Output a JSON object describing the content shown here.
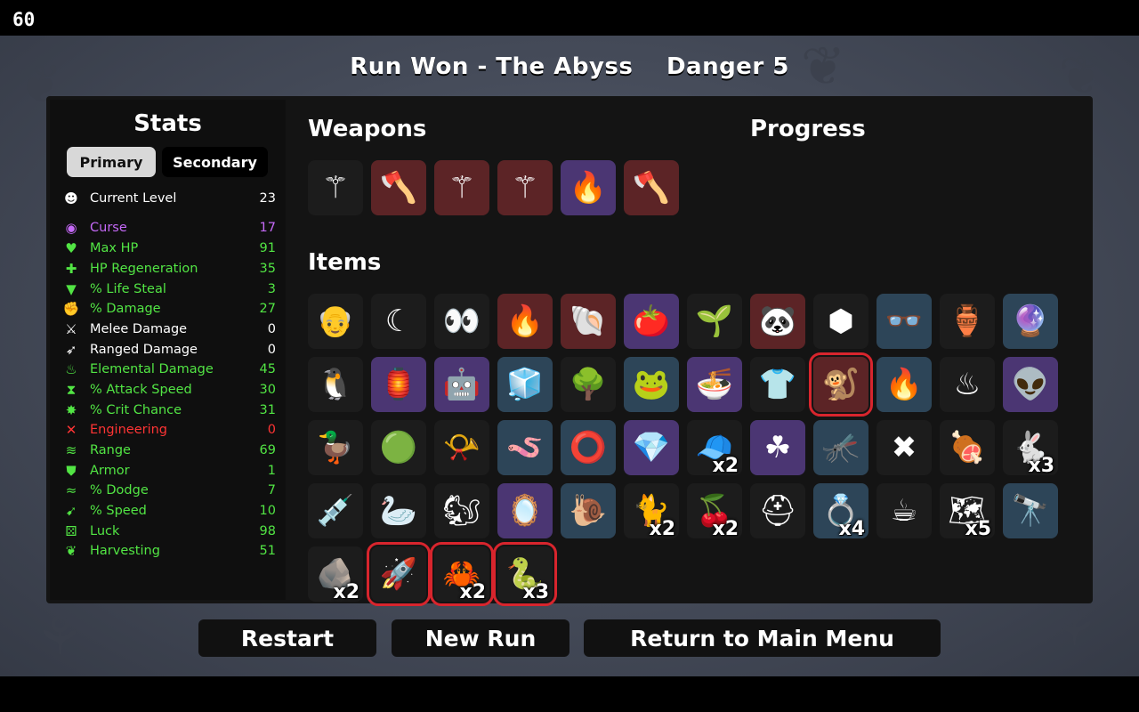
{
  "fps": "60",
  "title": {
    "run_result": "Run Won - The Abyss",
    "danger": "Danger 5"
  },
  "stats": {
    "title": "Stats",
    "tabs": {
      "primary": "Primary",
      "secondary": "Secondary"
    },
    "rows": [
      {
        "icon": "skull-level-icon",
        "glyph": "☻",
        "label": "Current Level",
        "value": "23",
        "color": "#ffffff"
      },
      {
        "icon": "curse-eye-icon",
        "glyph": "◉",
        "label": "Curse",
        "value": "17",
        "color": "#c569f7"
      },
      {
        "icon": "heart-icon",
        "glyph": "♥",
        "label": "Max HP",
        "value": "91",
        "color": "#52e544"
      },
      {
        "icon": "heart-plus-icon",
        "glyph": "✚",
        "label": "HP Regeneration",
        "value": "35",
        "color": "#52e544"
      },
      {
        "icon": "vampire-mouth-icon",
        "glyph": "▼",
        "label": "% Life Steal",
        "value": "3",
        "color": "#52e544"
      },
      {
        "icon": "fist-icon",
        "glyph": "✊",
        "label": "% Damage",
        "value": "27",
        "color": "#52e544"
      },
      {
        "icon": "sword-icon",
        "glyph": "⚔",
        "label": "Melee Damage",
        "value": "0",
        "color": "#ffffff"
      },
      {
        "icon": "bow-icon",
        "glyph": "➶",
        "label": "Ranged Damage",
        "value": "0",
        "color": "#ffffff"
      },
      {
        "icon": "flame-icon",
        "glyph": "♨",
        "label": "Elemental Damage",
        "value": "45",
        "color": "#52e544"
      },
      {
        "icon": "hourglass-icon",
        "glyph": "⧗",
        "label": "% Attack Speed",
        "value": "30",
        "color": "#52e544"
      },
      {
        "icon": "crit-star-icon",
        "glyph": "✸",
        "label": "% Crit Chance",
        "value": "31",
        "color": "#52e544"
      },
      {
        "icon": "wrench-icon",
        "glyph": "✕",
        "label": "Engineering",
        "value": "0",
        "color": "#ff3434"
      },
      {
        "icon": "range-waves-icon",
        "glyph": "≋",
        "label": "Range",
        "value": "69",
        "color": "#52e544"
      },
      {
        "icon": "shield-icon",
        "glyph": "⛊",
        "label": "Armor",
        "value": "1",
        "color": "#52e544"
      },
      {
        "icon": "wind-icon",
        "glyph": "≈",
        "label": "% Dodge",
        "value": "7",
        "color": "#52e544"
      },
      {
        "icon": "boot-icon",
        "glyph": "➹",
        "label": "% Speed",
        "value": "10",
        "color": "#52e544"
      },
      {
        "icon": "dice-icon",
        "glyph": "⚄",
        "label": "Luck",
        "value": "98",
        "color": "#52e544"
      },
      {
        "icon": "wheat-icon",
        "glyph": "❦",
        "label": "Harvesting",
        "value": "51",
        "color": "#52e544"
      }
    ]
  },
  "weapons_title": "Weapons",
  "progress_title": "Progress",
  "items_title": "Items",
  "weapons": [
    {
      "name": "wand-icon",
      "glyph": "⚚",
      "tier": 0
    },
    {
      "name": "axe-icon",
      "glyph": "🪓",
      "tier": 3
    },
    {
      "name": "wand-icon",
      "glyph": "⚚",
      "tier": 3
    },
    {
      "name": "wand-icon",
      "glyph": "⚚",
      "tier": 3
    },
    {
      "name": "fireball-icon",
      "glyph": "🔥",
      "tier": 2
    },
    {
      "name": "axe-icon",
      "glyph": "🪓",
      "tier": 3
    }
  ],
  "items": [
    {
      "name": "bald-head-icon",
      "glyph": "👴",
      "tier": 0
    },
    {
      "name": "crescent-moon-icon",
      "glyph": "☾",
      "tier": 0
    },
    {
      "name": "eyes-icon",
      "glyph": "👀",
      "tier": 0
    },
    {
      "name": "torch-icon",
      "glyph": "🔥",
      "tier": 3
    },
    {
      "name": "shell-icon",
      "glyph": "🐚",
      "tier": 3
    },
    {
      "name": "tomato-icon",
      "glyph": "🍅",
      "tier": 2
    },
    {
      "name": "sprout-icon",
      "glyph": "🌱",
      "tier": 0
    },
    {
      "name": "panda-icon",
      "glyph": "🐼",
      "tier": 3
    },
    {
      "name": "coal-icon",
      "glyph": "⬢",
      "tier": 0
    },
    {
      "name": "glasses-icon",
      "glyph": "👓",
      "tier": 1
    },
    {
      "name": "jar-icon",
      "glyph": "🏺",
      "tier": 0
    },
    {
      "name": "crystal-ball-icon",
      "glyph": "🔮",
      "tier": 1
    },
    {
      "name": "penguin-icon",
      "glyph": "🐧",
      "tier": 0
    },
    {
      "name": "lantern-icon",
      "glyph": "🏮",
      "tier": 2
    },
    {
      "name": "robot-bug-icon",
      "glyph": "🤖",
      "tier": 2
    },
    {
      "name": "ice-cube-icon",
      "glyph": "🧊",
      "tier": 1
    },
    {
      "name": "tree-icon",
      "glyph": "🌳",
      "tier": 0
    },
    {
      "name": "frog-icon",
      "glyph": "🐸",
      "tier": 1
    },
    {
      "name": "noodle-bowl-icon",
      "glyph": "🍜",
      "tier": 2
    },
    {
      "name": "plaid-shirt-icon",
      "glyph": "👕",
      "tier": 0
    },
    {
      "name": "monkey-icon",
      "glyph": "🐒",
      "tier": 3,
      "new": true
    },
    {
      "name": "campfire-icon",
      "glyph": "🔥",
      "tier": 1
    },
    {
      "name": "cauldron-icon",
      "glyph": "♨",
      "tier": 0
    },
    {
      "name": "alien-totem-icon",
      "glyph": "👽",
      "tier": 2
    },
    {
      "name": "rubber-duck-icon",
      "glyph": "🦆",
      "tier": 0
    },
    {
      "name": "slime-icon",
      "glyph": "🟢",
      "tier": 0
    },
    {
      "name": "whistle-icon",
      "glyph": "📯",
      "tier": 0
    },
    {
      "name": "worm-icon",
      "glyph": "🪱",
      "tier": 1
    },
    {
      "name": "donut-ring-icon",
      "glyph": "⭕",
      "tier": 1
    },
    {
      "name": "crystal-icon",
      "glyph": "💎",
      "tier": 2
    },
    {
      "name": "propeller-hat-icon",
      "glyph": "🧢",
      "tier": 0,
      "count": "x2"
    },
    {
      "name": "clover-icon",
      "glyph": "☘",
      "tier": 2
    },
    {
      "name": "mosquito-icon",
      "glyph": "🦟",
      "tier": 1
    },
    {
      "name": "thorns-icon",
      "glyph": "✖",
      "tier": 0
    },
    {
      "name": "meat-skewer-icon",
      "glyph": "🍖",
      "tier": 0
    },
    {
      "name": "bunny-icon",
      "glyph": "🐇",
      "tier": 0,
      "count": "x3"
    },
    {
      "name": "syringe-icon",
      "glyph": "💉",
      "tier": 0
    },
    {
      "name": "duck-head-icon",
      "glyph": "🦢",
      "tier": 0
    },
    {
      "name": "squirrel-icon",
      "glyph": "🐿",
      "tier": 0
    },
    {
      "name": "mirror-icon",
      "glyph": "🪞",
      "tier": 2
    },
    {
      "name": "snail-icon",
      "glyph": "🐌",
      "tier": 1
    },
    {
      "name": "cat-icon",
      "glyph": "🐈",
      "tier": 0,
      "count": "x2"
    },
    {
      "name": "cherries-icon",
      "glyph": "🍒",
      "tier": 0,
      "count": "x2"
    },
    {
      "name": "beanie-icon",
      "glyph": "⛑",
      "tier": 0
    },
    {
      "name": "bracelet-icon",
      "glyph": "💍",
      "tier": 1,
      "count": "x4"
    },
    {
      "name": "coffee-cup-icon",
      "glyph": "☕",
      "tier": 0
    },
    {
      "name": "treasure-map-icon",
      "glyph": "🗺",
      "tier": 0,
      "count": "x5"
    },
    {
      "name": "spyglass-icon",
      "glyph": "🔭",
      "tier": 1
    },
    {
      "name": "moss-rock-icon",
      "glyph": "🪨",
      "tier": 0,
      "count": "x2"
    },
    {
      "name": "rocket-icon",
      "glyph": "🚀",
      "tier": 0,
      "new": true
    },
    {
      "name": "claw-icon",
      "glyph": "🦀",
      "tier": 0,
      "count": "x2",
      "new": true
    },
    {
      "name": "snake-icon",
      "glyph": "🐍",
      "tier": 0,
      "count": "x3",
      "new": true
    }
  ],
  "tier_colors": {
    "0": "#1c1c1c",
    "1": "#2d4558",
    "2": "#4b3673",
    "3": "#5c2426"
  },
  "buttons": {
    "restart": "Restart",
    "new_run": "New Run",
    "main_menu": "Return to Main Menu"
  }
}
